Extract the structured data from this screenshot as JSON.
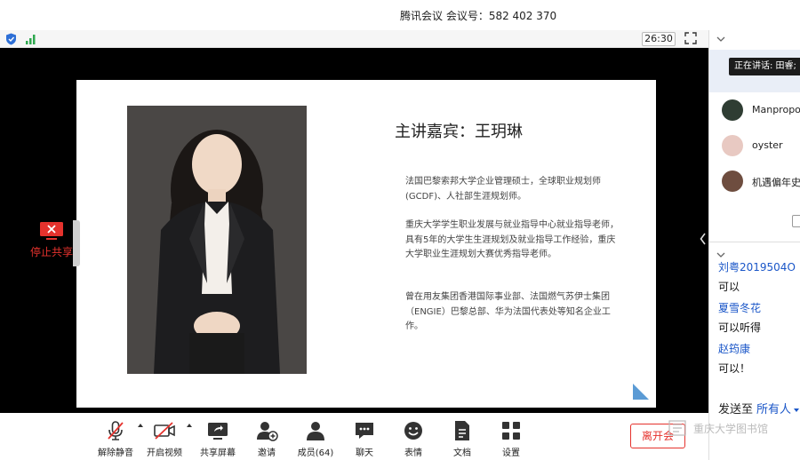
{
  "window": {
    "title": "腾讯会议 会议号：582 402 370"
  },
  "topbar": {
    "timer": "26:30"
  },
  "share": {
    "stop_label": "停止共享"
  },
  "slide": {
    "title": "主讲嘉宾：王玥琳",
    "para1": "法国巴黎索邦大学企业管理硕士，全球职业规划师(GCDF)、人社部生涯规划师。",
    "para2": "重庆大学学生职业发展与就业指导中心就业指导老师，具有5年的大学生生涯规划及就业指导工作经验，重庆大学职业生涯规划大赛优秀指导老师。",
    "para3": "曾在用友集团香港国际事业部、法国燃气苏伊士集团（ENGIE）巴黎总部、华为法国代表处等知名企业工作。"
  },
  "toolbar": {
    "unmute": "解除静音",
    "start_video": "开启视频",
    "share_screen": "共享屏幕",
    "invite": "邀请",
    "members": "成员(64)",
    "chat": "聊天",
    "reactions": "表情",
    "docs": "文档",
    "settings": "设置",
    "leave": "离开会"
  },
  "panel": {
    "speaking": "正在讲话: 田睿;",
    "members": [
      {
        "name": "Manpropose"
      },
      {
        "name": "oyster"
      },
      {
        "name": "机遇偏年史的"
      }
    ]
  },
  "chat": {
    "messages": [
      {
        "user": "刘粤2019504O",
        "text": "可以"
      },
      {
        "user": "夏雪冬花",
        "text": "可以听得"
      },
      {
        "user": "赵筠康",
        "text": "可以！"
      }
    ],
    "send_label": "发送至",
    "send_target": "所有人"
  },
  "watermark": {
    "text": "重庆大学图书馆"
  },
  "colors": {
    "accent_red": "#e5322d",
    "link_blue": "#1a56c8"
  }
}
